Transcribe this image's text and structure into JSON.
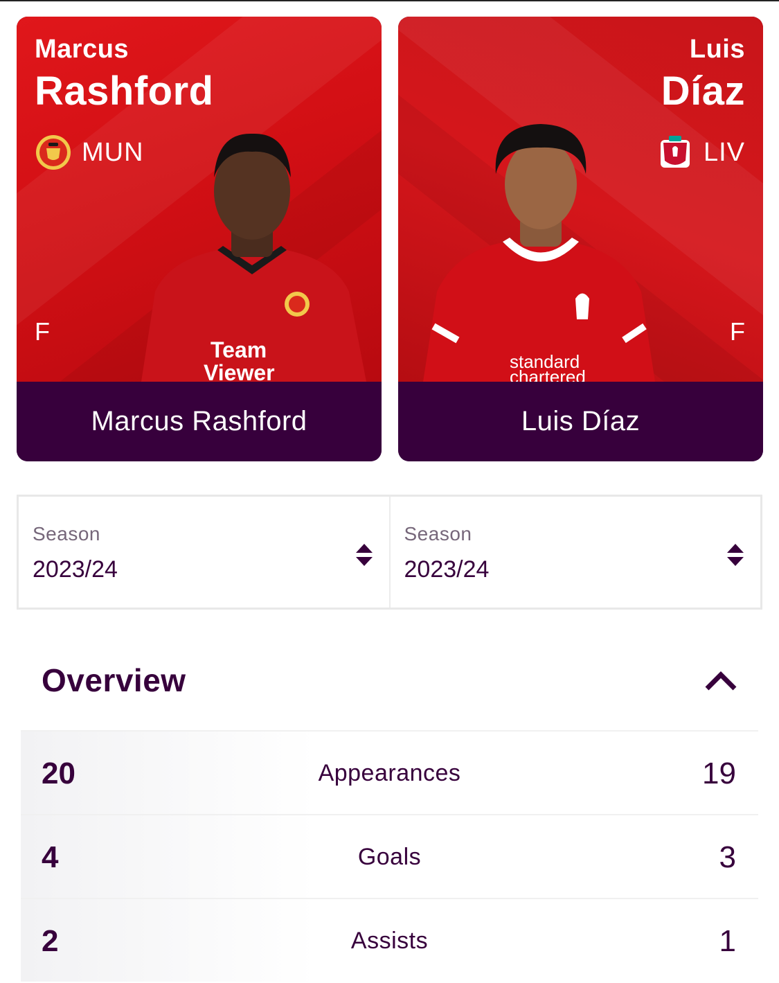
{
  "players": [
    {
      "first_name": "Marcus",
      "last_name": "Rashford",
      "club_abbr": "MUN",
      "position": "F",
      "full_name": "Marcus Rashford",
      "kit_color": "#d7141a",
      "badge_color": "#da291c"
    },
    {
      "first_name": "Luis",
      "last_name": "Díaz",
      "club_abbr": "LIV",
      "position": "F",
      "full_name": "Luis Díaz",
      "kit_color": "#d20f16",
      "badge_color": "#c8102e"
    }
  ],
  "season_selectors": [
    {
      "label": "Season",
      "value": "2023/24"
    },
    {
      "label": "Season",
      "value": "2023/24"
    }
  ],
  "overview": {
    "title": "Overview",
    "rows": [
      {
        "left": "20",
        "label": "Appearances",
        "right": "19"
      },
      {
        "left": "4",
        "label": "Goals",
        "right": "3"
      },
      {
        "left": "2",
        "label": "Assists",
        "right": "1"
      }
    ]
  },
  "colors": {
    "primary_purple": "#37003c",
    "card_red": "#d7141a"
  }
}
